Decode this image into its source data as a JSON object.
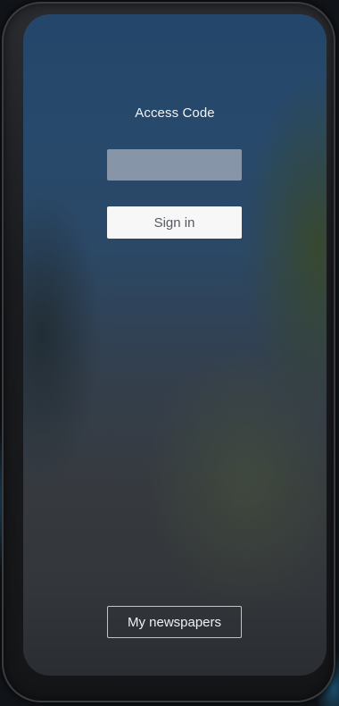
{
  "login": {
    "title": "Access Code",
    "code_value": "",
    "signin_label": "Sign in"
  },
  "footer": {
    "newspapers_label": "My newspapers"
  }
}
